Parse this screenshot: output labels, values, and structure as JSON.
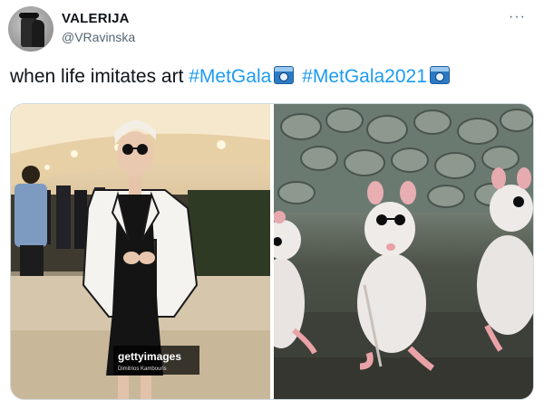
{
  "user": {
    "display_name": "VALERIJA",
    "handle": "@VRavinska"
  },
  "menu": {
    "more_label": "···"
  },
  "tweet": {
    "text_prefix": "when life imitates art ",
    "hashtag_1": "#MetGala",
    "hashtag_2": "#MetGala2021",
    "emoji": "camera-icon"
  },
  "media": {
    "left_photo": {
      "watermark_brand": "gettyimages",
      "watermark_credit": "Dimitrios Kambouris"
    },
    "right_photo": {}
  },
  "colors": {
    "link": "#1d9bf0",
    "secondary_text": "#536471",
    "border": "#cfd9de"
  }
}
